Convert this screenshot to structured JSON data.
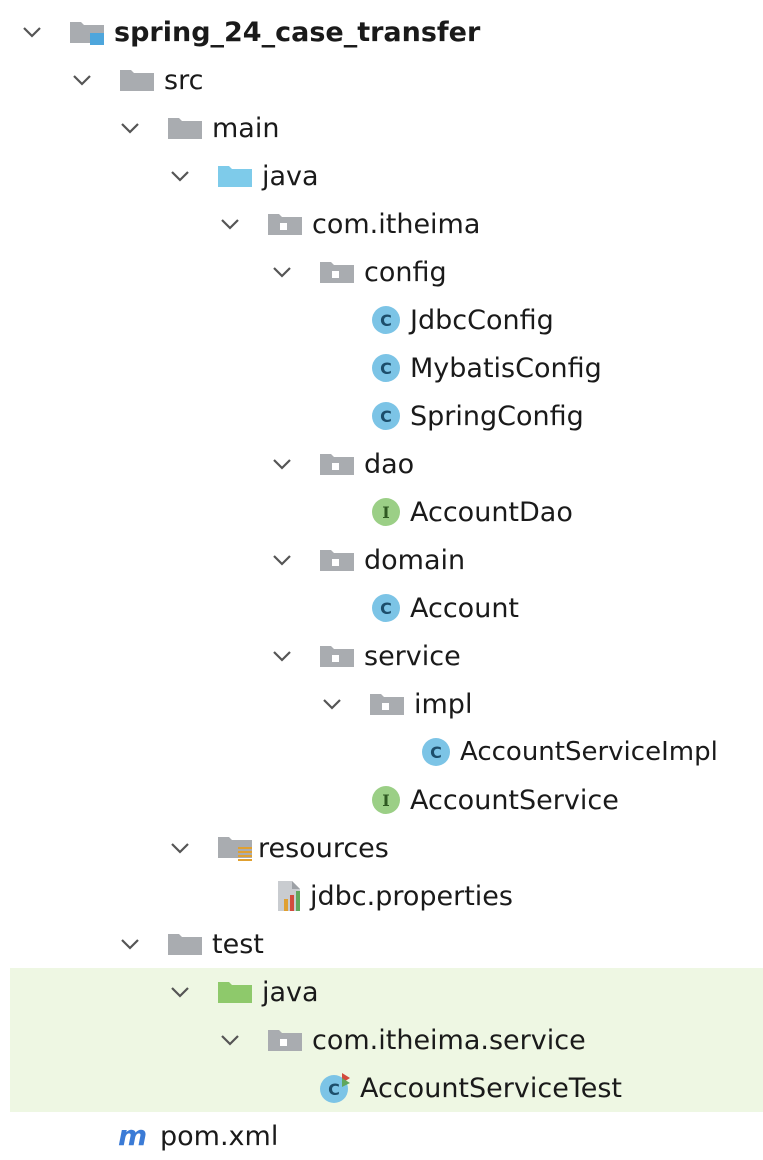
{
  "tree": {
    "root": {
      "label": "spring_24_case_transfer",
      "icon": "module-folder-icon"
    },
    "src": {
      "label": "src",
      "icon": "folder-icon"
    },
    "main": {
      "label": "main",
      "icon": "folder-icon"
    },
    "main_java": {
      "label": "java",
      "icon": "source-root-folder-icon"
    },
    "pkg": {
      "label": "com.itheima",
      "icon": "package-icon"
    },
    "config": {
      "label": "config",
      "icon": "package-icon"
    },
    "jdbc_config": {
      "label": "JdbcConfig",
      "icon": "class-icon",
      "glyph": "C"
    },
    "mybatis_config": {
      "label": "MybatisConfig",
      "icon": "class-icon",
      "glyph": "C"
    },
    "spring_config": {
      "label": "SpringConfig",
      "icon": "class-icon",
      "glyph": "C"
    },
    "dao": {
      "label": "dao",
      "icon": "package-icon"
    },
    "account_dao": {
      "label": "AccountDao",
      "icon": "interface-icon",
      "glyph": "I"
    },
    "domain": {
      "label": "domain",
      "icon": "package-icon"
    },
    "account": {
      "label": "Account",
      "icon": "class-icon",
      "glyph": "C"
    },
    "service": {
      "label": "service",
      "icon": "package-icon"
    },
    "impl": {
      "label": "impl",
      "icon": "package-icon"
    },
    "account_service_impl": {
      "label": "AccountServiceImpl",
      "icon": "class-icon",
      "glyph": "C"
    },
    "account_service": {
      "label": "AccountService",
      "icon": "interface-icon",
      "glyph": "I"
    },
    "resources": {
      "label": "resources",
      "icon": "resources-folder-icon"
    },
    "jdbc_properties": {
      "label": "jdbc.properties",
      "icon": "properties-file-icon"
    },
    "test": {
      "label": "test",
      "icon": "folder-icon"
    },
    "test_java": {
      "label": "java",
      "icon": "test-root-folder-icon"
    },
    "test_pkg": {
      "label": "com.itheima.service",
      "icon": "package-icon"
    },
    "account_service_test": {
      "label": "AccountServiceTest",
      "icon": "test-class-icon",
      "glyph": "C"
    },
    "pom": {
      "label": "pom.xml",
      "icon": "maven-icon",
      "glyph": "m"
    }
  },
  "colors": {
    "folder_gray": "#a9acb0",
    "source_blue": "#7ecbea",
    "test_green": "#8ec96b",
    "class_blue": "#7cc4e6",
    "interface_green": "#9bcf86",
    "maven_blue": "#3b7bd6",
    "selected_test_bg": "#eef7e3"
  }
}
